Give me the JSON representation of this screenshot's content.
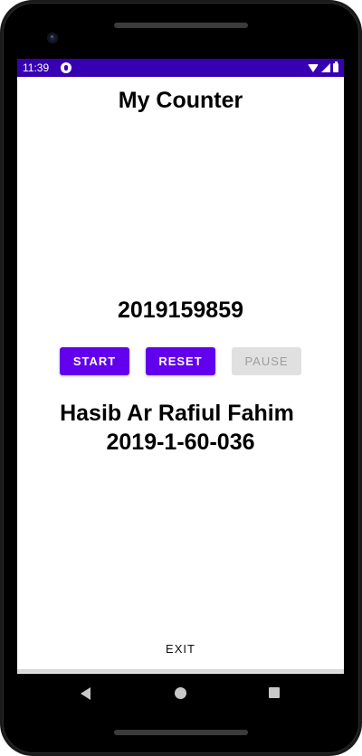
{
  "status_bar": {
    "time": "11:39",
    "icons": [
      "app-notification-icon",
      "wifi-icon",
      "signal-icon",
      "battery-icon"
    ],
    "color": "#3700b3"
  },
  "app": {
    "title": "My Counter",
    "counter_value": "2019159859",
    "buttons": {
      "start": "START",
      "reset": "RESET",
      "pause": "PAUSE"
    },
    "student_name": "Hasib Ar Rafiul Fahim",
    "student_id": "2019-1-60-036",
    "exit_label": "EXIT",
    "accent_color": "#6200ee",
    "disabled_color": "#e0e0e0"
  },
  "navigation": {
    "icons": [
      "back-icon",
      "home-icon",
      "recents-icon"
    ]
  }
}
